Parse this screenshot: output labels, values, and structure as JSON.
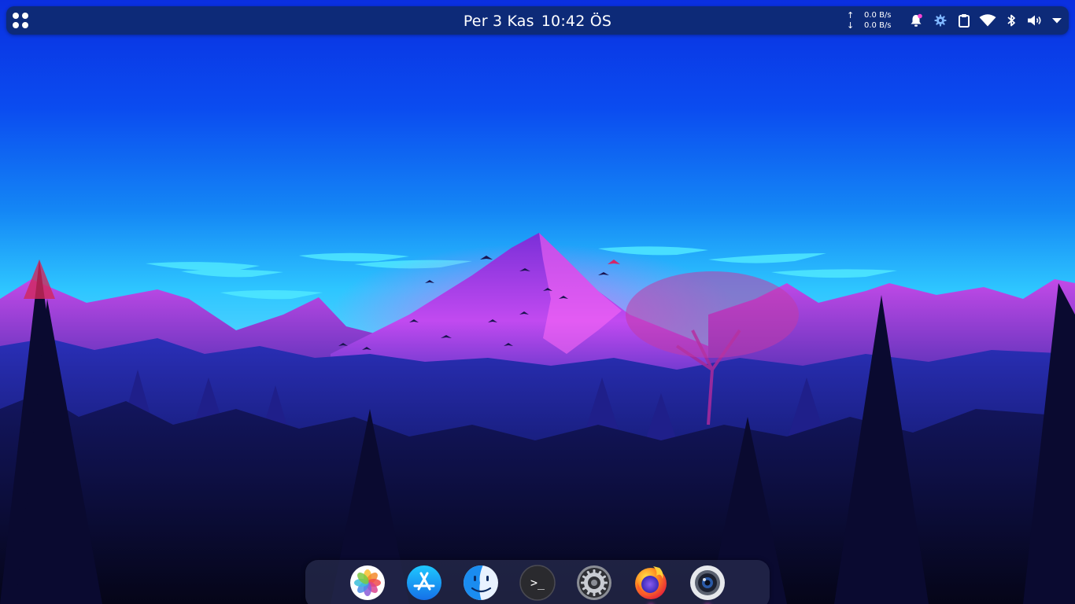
{
  "panel": {
    "launcher_icon": "apps-grid-icon",
    "clock": {
      "date": "Per 3 Kas",
      "time": "10:42 ÖS"
    },
    "network_speed": {
      "upload": "0.0 B/s",
      "download": "0.0 B/s",
      "upload_arrow": "↑",
      "download_arrow": "↓"
    },
    "tray_icons": [
      "notification-bell-icon",
      "settings-gear-icon",
      "clipboard-icon",
      "wifi-icon",
      "bluetooth-icon",
      "volume-icon",
      "system-menu-arrow-icon"
    ]
  },
  "dock": {
    "apps": [
      {
        "name": "Photos",
        "icon": "photos-app-icon",
        "running": false
      },
      {
        "name": "App Store",
        "icon": "app-store-icon",
        "running": false
      },
      {
        "name": "Finder",
        "icon": "finder-icon",
        "running": false
      },
      {
        "name": "Terminal",
        "icon": "terminal-icon",
        "glyph": ">_",
        "running": false
      },
      {
        "name": "System Settings",
        "icon": "system-settings-icon",
        "running": false
      },
      {
        "name": "Firefox",
        "icon": "firefox-icon",
        "running": true
      },
      {
        "name": "Camera",
        "icon": "camera-app-icon",
        "running": true
      }
    ]
  },
  "colors": {
    "panel_bg": "#0d2a78",
    "sky_top": "#0a3fe0",
    "sky_horizon": "#23c8ff",
    "mountain_magenta": "#e24bff",
    "forest_dark": "#07072a",
    "running_indicator": "#ff44d4",
    "notification_dot": "#ff44d4"
  }
}
